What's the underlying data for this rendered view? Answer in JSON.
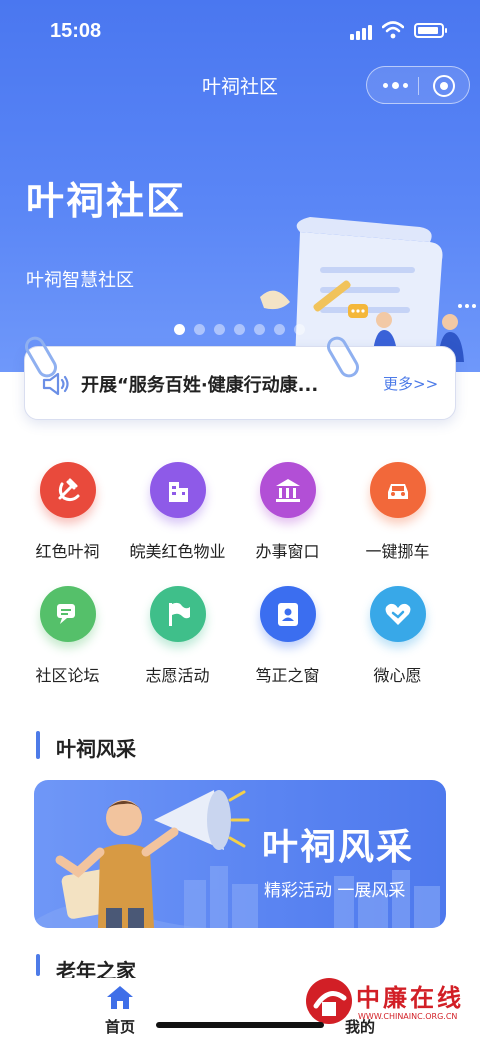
{
  "status_bar": {
    "time": "15:08"
  },
  "nav": {
    "title": "叶祠社区"
  },
  "hero": {
    "title": "叶祠社区",
    "subtitle": "叶祠智慧社区",
    "slide_count": 7,
    "active_slide": 1
  },
  "notice": {
    "text": "开展“服务百姓·健康行动康...",
    "more": "更多>>"
  },
  "services": [
    {
      "label": "红色叶祠",
      "icon": "hammer-sickle-icon",
      "color": "#e94a3c"
    },
    {
      "label": "皖美红色物业",
      "icon": "building-icon",
      "color": "#8e5ae8"
    },
    {
      "label": "办事窗口",
      "icon": "government-building-icon",
      "color": "#b24fd6"
    },
    {
      "label": "一键挪车",
      "icon": "car-icon",
      "color": "#f2683a"
    },
    {
      "label": "社区论坛",
      "icon": "chat-icon",
      "color": "#55c06a"
    },
    {
      "label": "志愿活动",
      "icon": "flag-icon",
      "color": "#3fbf8a"
    },
    {
      "label": "笃正之窗",
      "icon": "id-card-icon",
      "color": "#3b6ef0"
    },
    {
      "label": "微心愿",
      "icon": "heart-handshake-icon",
      "color": "#38a8e8"
    }
  ],
  "sections": {
    "feature_title": "叶祠风采",
    "elder_title": "老年之家"
  },
  "banner": {
    "title": "叶祠风采",
    "subtitle": "精彩活动 一展风采"
  },
  "tabbar": {
    "home": "首页",
    "mine": "我的"
  },
  "watermark": {
    "title": "中廉在线",
    "url": "WWW.CHINAINC.ORG.CN"
  },
  "colors": {
    "primary": "#4d7be8",
    "hero_top": "#4a77f0"
  }
}
